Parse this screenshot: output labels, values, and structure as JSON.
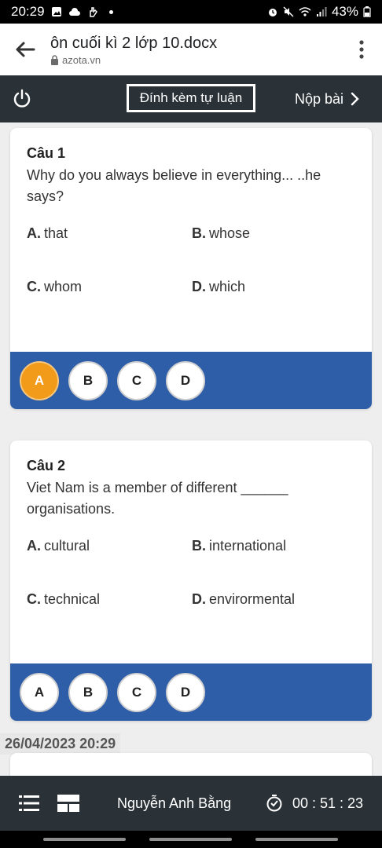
{
  "status_bar": {
    "time": "20:29",
    "battery": "43%",
    "icons": [
      "gallery-icon",
      "cloud-icon",
      "gesture-icon",
      "alarm-icon",
      "mute-icon",
      "wifi-icon",
      "signal-icon",
      "battery-icon"
    ]
  },
  "browser": {
    "page_title": "ôn cuối kì 2 lớp 10.docx",
    "domain": "azota.vn"
  },
  "toolbar": {
    "attach_label": "Đính kèm tự luận",
    "submit_label": "Nộp bài"
  },
  "questions": [
    {
      "number_label": "Câu 1",
      "text": "Why do you always believe in everything... ..he says?",
      "options": [
        {
          "letter": "A.",
          "text": "that"
        },
        {
          "letter": "B.",
          "text": "whose"
        },
        {
          "letter": "C.",
          "text": "whom"
        },
        {
          "letter": "D.",
          "text": "which"
        }
      ],
      "answers": [
        "A",
        "B",
        "C",
        "D"
      ],
      "selected": "A"
    },
    {
      "number_label": "Câu 2",
      "text": "Viet Nam is a member of different ______ organisations.",
      "options": [
        {
          "letter": "A.",
          "text": "cultural"
        },
        {
          "letter": "B.",
          "text": "international"
        },
        {
          "letter": "C.",
          "text": "technical"
        },
        {
          "letter": "D.",
          "text": "envirormental"
        }
      ],
      "answers": [
        "A",
        "B",
        "C",
        "D"
      ],
      "selected": null
    }
  ],
  "timestamp": "26/04/2023 20:29",
  "bottom_bar": {
    "student_name": "Nguyễn Anh Bằng",
    "timer": "00 : 51 : 23"
  },
  "colors": {
    "toolbar_bg": "#2a3238",
    "answer_bar_bg": "#2f5ea8",
    "selected_answer": "#f29a1a"
  }
}
